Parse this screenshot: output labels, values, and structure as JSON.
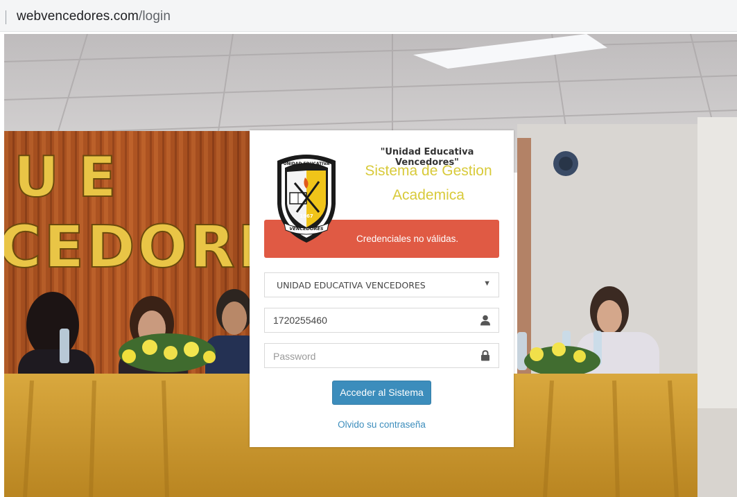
{
  "browser": {
    "url_host": "webvencedores.com",
    "url_path": "/login"
  },
  "background": {
    "banner_letters_top": "U E",
    "banner_letters_bottom": "CEDORE"
  },
  "login": {
    "logo": {
      "top_text": "UNIDAD EDUCATIVA",
      "year": "1967",
      "ribbon": "VENCEDORES"
    },
    "school_name": "\"Unidad Educativa Vencedores\"",
    "system_line1": "Sistema de Gestion",
    "system_line2": "Academica",
    "alert_message": "Credenciales no válidas.",
    "institution_select": {
      "selected": "UNIDAD EDUCATIVA VENCEDORES"
    },
    "username": {
      "value": "1720255460"
    },
    "password": {
      "placeholder": "Password"
    },
    "submit_label": "Acceder al Sistema",
    "forgot_label": "Olvido su contraseña"
  },
  "colors": {
    "accent_blue": "#3c8dbc",
    "alert_red": "#e05a44",
    "title_yellow": "#d8ca3a"
  }
}
